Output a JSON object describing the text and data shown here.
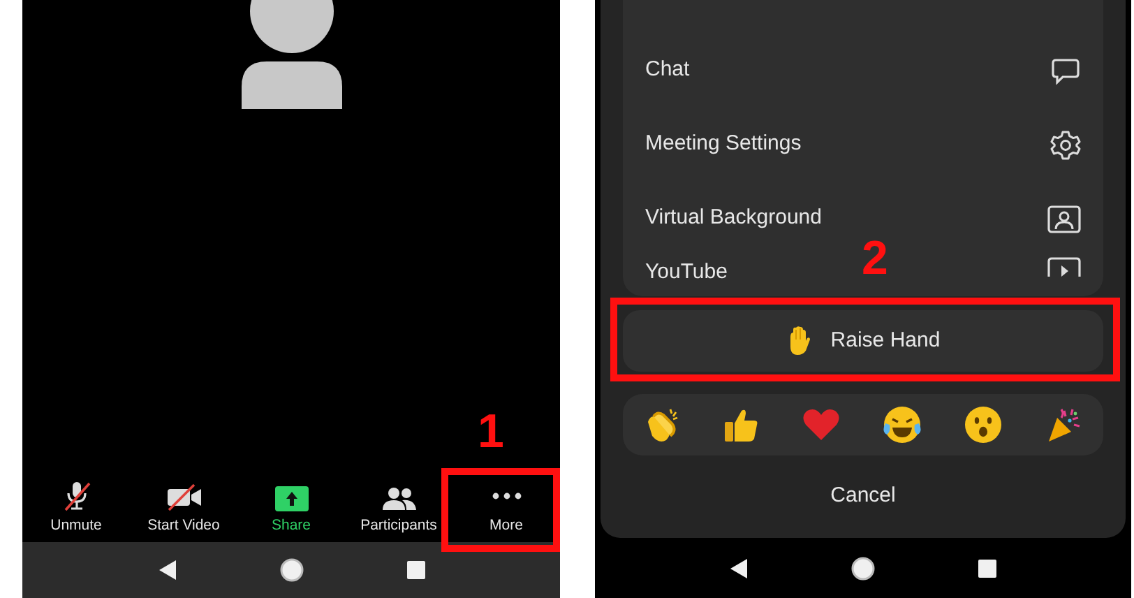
{
  "left_phone": {
    "toolbar": [
      {
        "kind": "mic",
        "label": "Unmute",
        "off": true
      },
      {
        "kind": "video",
        "label": "Start Video",
        "off": true
      },
      {
        "kind": "share",
        "label": "Share",
        "color": "#2fd166"
      },
      {
        "kind": "participants",
        "label": "Participants"
      },
      {
        "kind": "more",
        "label": "More"
      }
    ]
  },
  "right_phone": {
    "menu_items": [
      {
        "kind": "chat",
        "label": "Chat"
      },
      {
        "kind": "settings",
        "label": "Meeting Settings"
      },
      {
        "kind": "background",
        "label": "Virtual Background"
      },
      {
        "kind": "youtube",
        "label": "YouTube"
      }
    ],
    "raise_hand": {
      "label": "Raise Hand"
    },
    "reactions": [
      {
        "kind": "clap"
      },
      {
        "kind": "thumbs"
      },
      {
        "kind": "heart"
      },
      {
        "kind": "laugh"
      },
      {
        "kind": "wow"
      },
      {
        "kind": "party"
      }
    ],
    "cancel": "Cancel"
  },
  "annotations": [
    {
      "label": "1"
    },
    {
      "label": "2"
    }
  ]
}
